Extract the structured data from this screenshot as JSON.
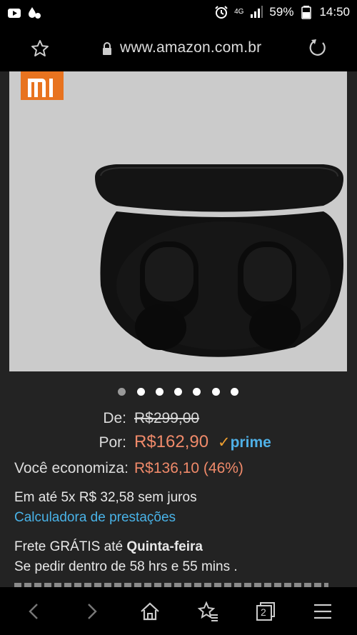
{
  "status_bar": {
    "network": "4G",
    "battery": "59%",
    "time": "14:50"
  },
  "browser": {
    "url": "www.amazon.com.br"
  },
  "product": {
    "image_alt": "Fone de ouvido Xiaomi",
    "brand_logo_text": "mi",
    "carousel": {
      "total": 7,
      "active": 0
    }
  },
  "pricing": {
    "de_label": "De:",
    "de_value": "R$299,00",
    "por_label": "Por:",
    "por_value": "R$162,90",
    "prime": "prime",
    "economiza_label": "Você economiza:",
    "economiza_value": "R$136,10 (46%)"
  },
  "installments": {
    "text": "Em até 5x R$ 32,58 sem juros",
    "calculator_link": "Calculadora de prestações"
  },
  "shipping": {
    "line1_prefix": "Frete GRÁTIS até ",
    "line1_day": "Quinta-feira",
    "line2": "Se pedir dentro de 58 hrs e 55 mins ."
  },
  "icons": {
    "bookmark": "star-icon",
    "secure": "lock-icon",
    "reload": "reload-icon",
    "back": "chevron-left-icon",
    "forward": "chevron-right-icon",
    "home": "home-icon",
    "bookmarks": "star-list-icon",
    "tabs": "tabs-icon",
    "menu": "menu-icon"
  },
  "tabs_count": "2"
}
